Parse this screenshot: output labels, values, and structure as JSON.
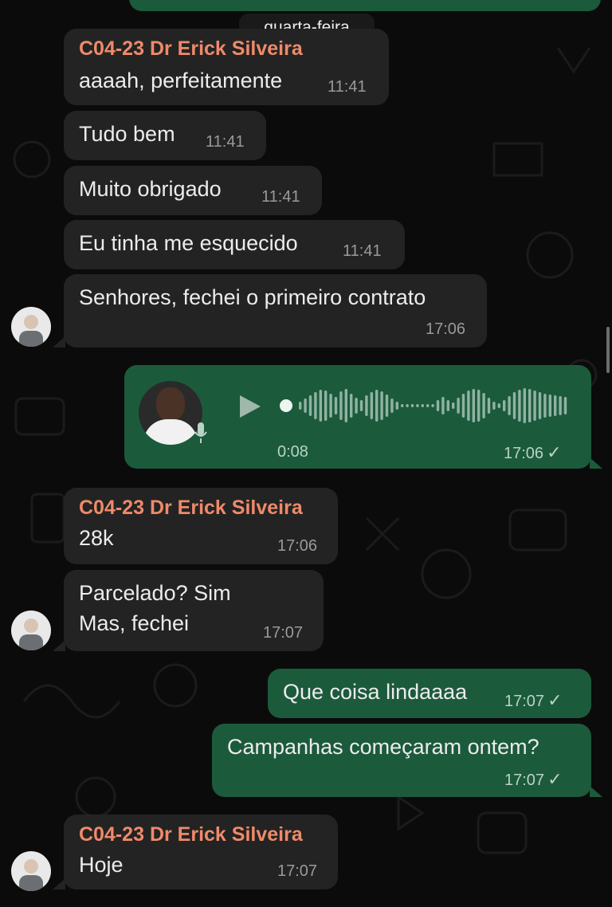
{
  "date_separator": "quarta-feira",
  "messages": [
    {
      "sender": "C04-23 Dr Erick Silveira",
      "text": "aaaah, perfeitamente",
      "time": "11:41"
    },
    {
      "text": "Tudo bem",
      "time": "11:41"
    },
    {
      "text": "Muito obrigado",
      "time": "11:41"
    },
    {
      "text": "Eu tinha me esquecido",
      "time": "11:41"
    },
    {
      "text": "Senhores, fechei o primeiro contrato",
      "time": "17:06"
    },
    {
      "type": "voice",
      "duration": "0:08",
      "time": "17:06",
      "status": "✓"
    },
    {
      "sender": "C04-23 Dr Erick Silveira",
      "text": "28k",
      "time": "17:06"
    },
    {
      "lines": [
        "Parcelado? Sim",
        "Mas, fechei"
      ],
      "time": "17:07"
    },
    {
      "text": "Que coisa lindaaaa",
      "time": "17:07",
      "status": "✓"
    },
    {
      "text": "Campanhas começaram ontem?",
      "time": "17:07",
      "status": "✓"
    },
    {
      "sender": "C04-23 Dr Erick Silveira",
      "text": "Hoje",
      "time": "17:07"
    }
  ],
  "colors": {
    "incoming_bubble": "#232323",
    "outgoing_bubble": "#1c5a3c",
    "sender_name": "#ee8a6a",
    "background": "#0b0b0b"
  },
  "icons": {
    "play": "play-icon",
    "mic": "mic-icon",
    "check": "check-icon"
  }
}
